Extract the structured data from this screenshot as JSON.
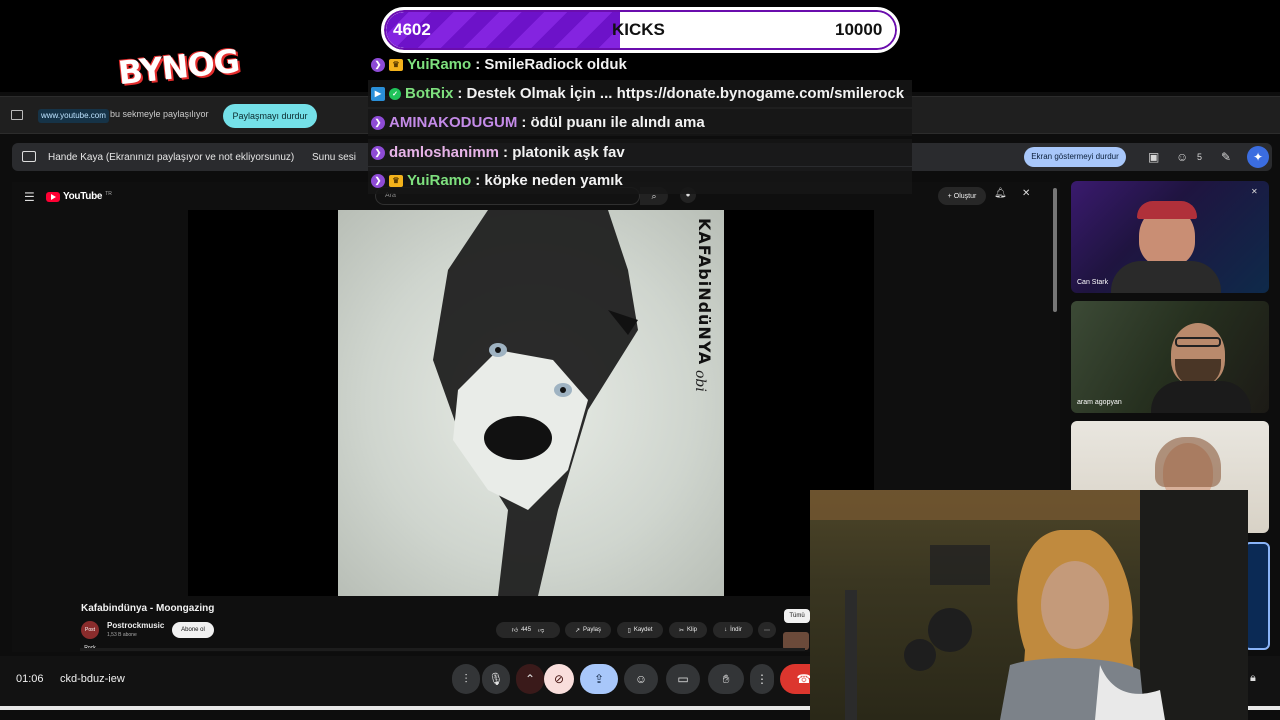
{
  "overlay": {
    "logo": "BYNOG",
    "kicks": {
      "current": "4602",
      "label": "KICKS",
      "goal": "10000",
      "progress": 0.4602
    },
    "chat": [
      {
        "user": "YuiRamo",
        "user_color": "#7ee07e",
        "message": ": SmileRadiock olduk",
        "badges": [
          "sub-badge-icon",
          "crown-icon"
        ]
      },
      {
        "user": "BotRix",
        "user_color": "#7ee07e",
        "message": ": Destek Olmak İçin ... https://donate.bynogame.com/smilerock",
        "badges": [
          "bot-icon",
          "verified-icon"
        ]
      },
      {
        "user": "AMINAKODUGUM",
        "user_color": "#c48be8",
        "message": ": ödül puanı ile alındı ama",
        "badges": [
          "sub-badge-icon"
        ]
      },
      {
        "user": "damloshanimm",
        "user_color": "#e7b3e8",
        "message": ": platonik aşk fav",
        "badges": [
          "sub-badge-icon"
        ]
      },
      {
        "user": "YuiRamo",
        "user_color": "#7ee07e",
        "message": ": köpke neden yamık",
        "badges": [
          "sub-badge-icon",
          "crown-icon"
        ]
      }
    ]
  },
  "share_bar": {
    "url": "www.youtube.com",
    "text": "bu sekmeyle paylaşılıyor",
    "stop_button": "Paylaşmayı durdur"
  },
  "present_bar": {
    "text": "Hande Kaya (Ekranınızı paylaşıyor ve not ekliyorsunuz)",
    "sound_label": "Sunu sesi",
    "stop_button": "Ekran göstermeyi durdur",
    "participant_count": "5"
  },
  "youtube": {
    "logo_text": "YouTube",
    "country": "TR",
    "search_placeholder": "Ara",
    "create_button": "Oluştur",
    "video_title": "Kafabindünya - Moongazing",
    "album_artist": "KAFAbiNdüNYA",
    "album_title": "obi",
    "channel_avatar": "Post Rock",
    "channel_name": "Postrockmusic",
    "channel_subs": "1,53 B abone",
    "subscribe_button": "Abone ol",
    "likes": "445",
    "share": "Paylaş",
    "save": "Kaydet",
    "clip": "Klip",
    "download": "İndir",
    "all_chip": "Tümü"
  },
  "participants": [
    {
      "name": "Can Stark"
    },
    {
      "name": "aram agopyan"
    },
    {
      "name": ""
    }
  ],
  "footer": {
    "time": "01:06",
    "meeting_code": "ckd-bduz-iew"
  }
}
